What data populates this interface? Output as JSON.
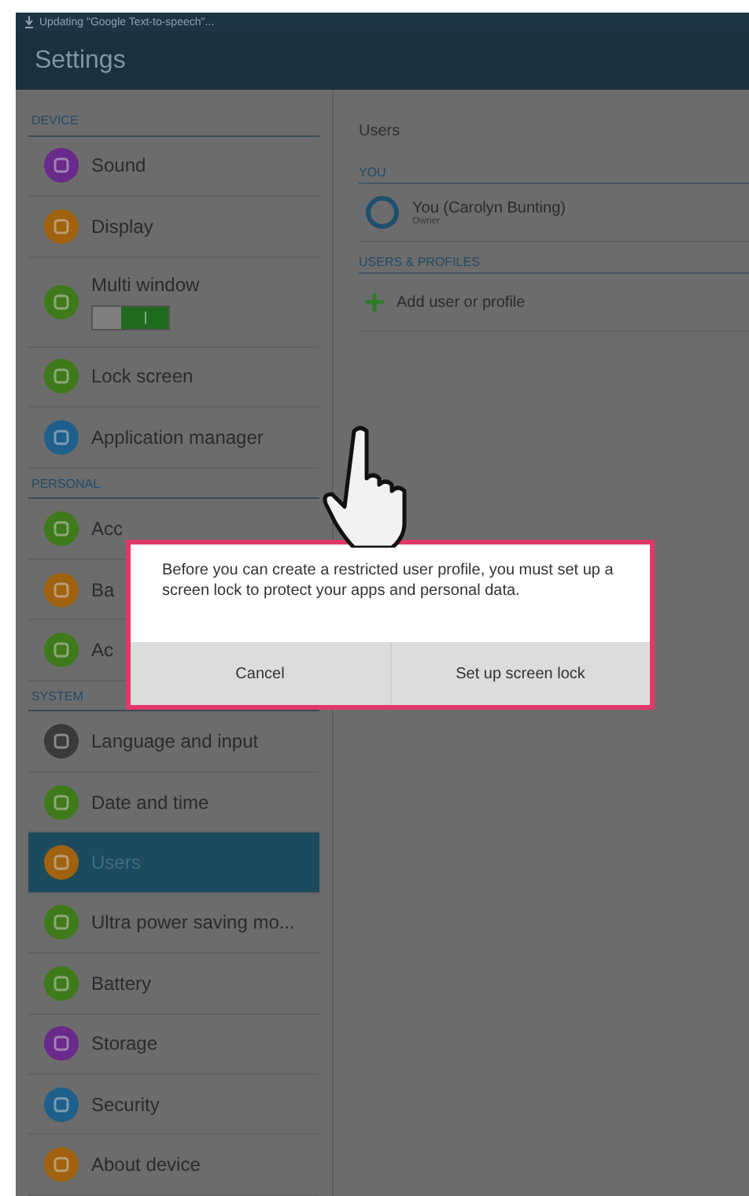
{
  "status_bar": {
    "notification": "Updating \"Google Text-to-speech\"..."
  },
  "window": {
    "title": "Settings"
  },
  "sidebar": {
    "sections": [
      {
        "header": "DEVICE",
        "items": [
          {
            "kind": "item",
            "label": "Sound",
            "color": "#6a2a8c",
            "selected": false
          },
          {
            "kind": "item",
            "label": "Display",
            "color": "#a0620e",
            "selected": false
          },
          {
            "kind": "toggle",
            "label": "Multi window",
            "color": "#3f7a1a",
            "selected": false,
            "on": true
          },
          {
            "kind": "item",
            "label": "Lock screen",
            "color": "#3f7a1a",
            "selected": false
          },
          {
            "kind": "item",
            "label": "Application manager",
            "color": "#1f5f8c",
            "selected": false
          }
        ]
      },
      {
        "header": "PERSONAL",
        "items": [
          {
            "kind": "item",
            "label": "Acc",
            "color": "#3f7a1a",
            "selected": false
          },
          {
            "kind": "item",
            "label": "Ba",
            "color": "#a0620e",
            "selected": false
          },
          {
            "kind": "item",
            "label": "Ac",
            "color": "#3f7a1a",
            "selected": false
          }
        ]
      },
      {
        "header": "SYSTEM",
        "items": [
          {
            "kind": "item",
            "label": "Language and input",
            "color": "#3a3a3a",
            "selected": false
          },
          {
            "kind": "item",
            "label": "Date and time",
            "color": "#3f7a1a",
            "selected": false
          },
          {
            "kind": "item",
            "label": "Users",
            "color": "#a0620e",
            "selected": true
          },
          {
            "kind": "item",
            "label": "Ultra power saving mo...",
            "color": "#3f7a1a",
            "selected": false
          },
          {
            "kind": "item",
            "label": "Battery",
            "color": "#3f7a1a",
            "selected": false
          },
          {
            "kind": "item",
            "label": "Storage",
            "color": "#6a2a8c",
            "selected": false
          },
          {
            "kind": "item",
            "label": "Security",
            "color": "#1f5f8c",
            "selected": false
          },
          {
            "kind": "item",
            "label": "About device",
            "color": "#a0620e",
            "selected": false
          }
        ]
      }
    ]
  },
  "content": {
    "title": "Users",
    "sections": [
      {
        "header": "YOU",
        "rows": [
          {
            "kind": "user",
            "label": "You (Carolyn Bunting)",
            "subtitle": "Owner"
          }
        ]
      },
      {
        "header": "USERS & PROFILES",
        "rows": [
          {
            "kind": "add",
            "label": "Add user or profile"
          }
        ]
      }
    ]
  },
  "dialog": {
    "message": "Before you can create a restricted user profile, you must set up a screen lock to protect your apps and personal data.",
    "buttons": [
      "Cancel",
      "Set up screen lock"
    ]
  }
}
